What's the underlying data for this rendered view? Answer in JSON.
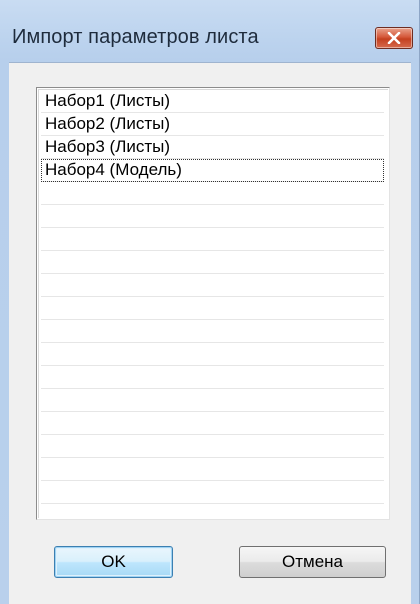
{
  "window": {
    "title": "Импорт параметров листа",
    "close_icon": "close-icon"
  },
  "list": {
    "items": [
      {
        "label": "Набор1 (Листы)",
        "focused": false
      },
      {
        "label": "Набор2 (Листы)",
        "focused": false
      },
      {
        "label": "Набор3 (Листы)",
        "focused": false
      },
      {
        "label": "Набор4 (Модель)",
        "focused": true
      }
    ],
    "empty_row_count": 14
  },
  "buttons": {
    "ok_label": "OK",
    "cancel_label": "Отмена"
  },
  "colors": {
    "frame": "#b9d0ec",
    "close_button": "#c4401f",
    "default_button_border": "#3c7fb1"
  }
}
